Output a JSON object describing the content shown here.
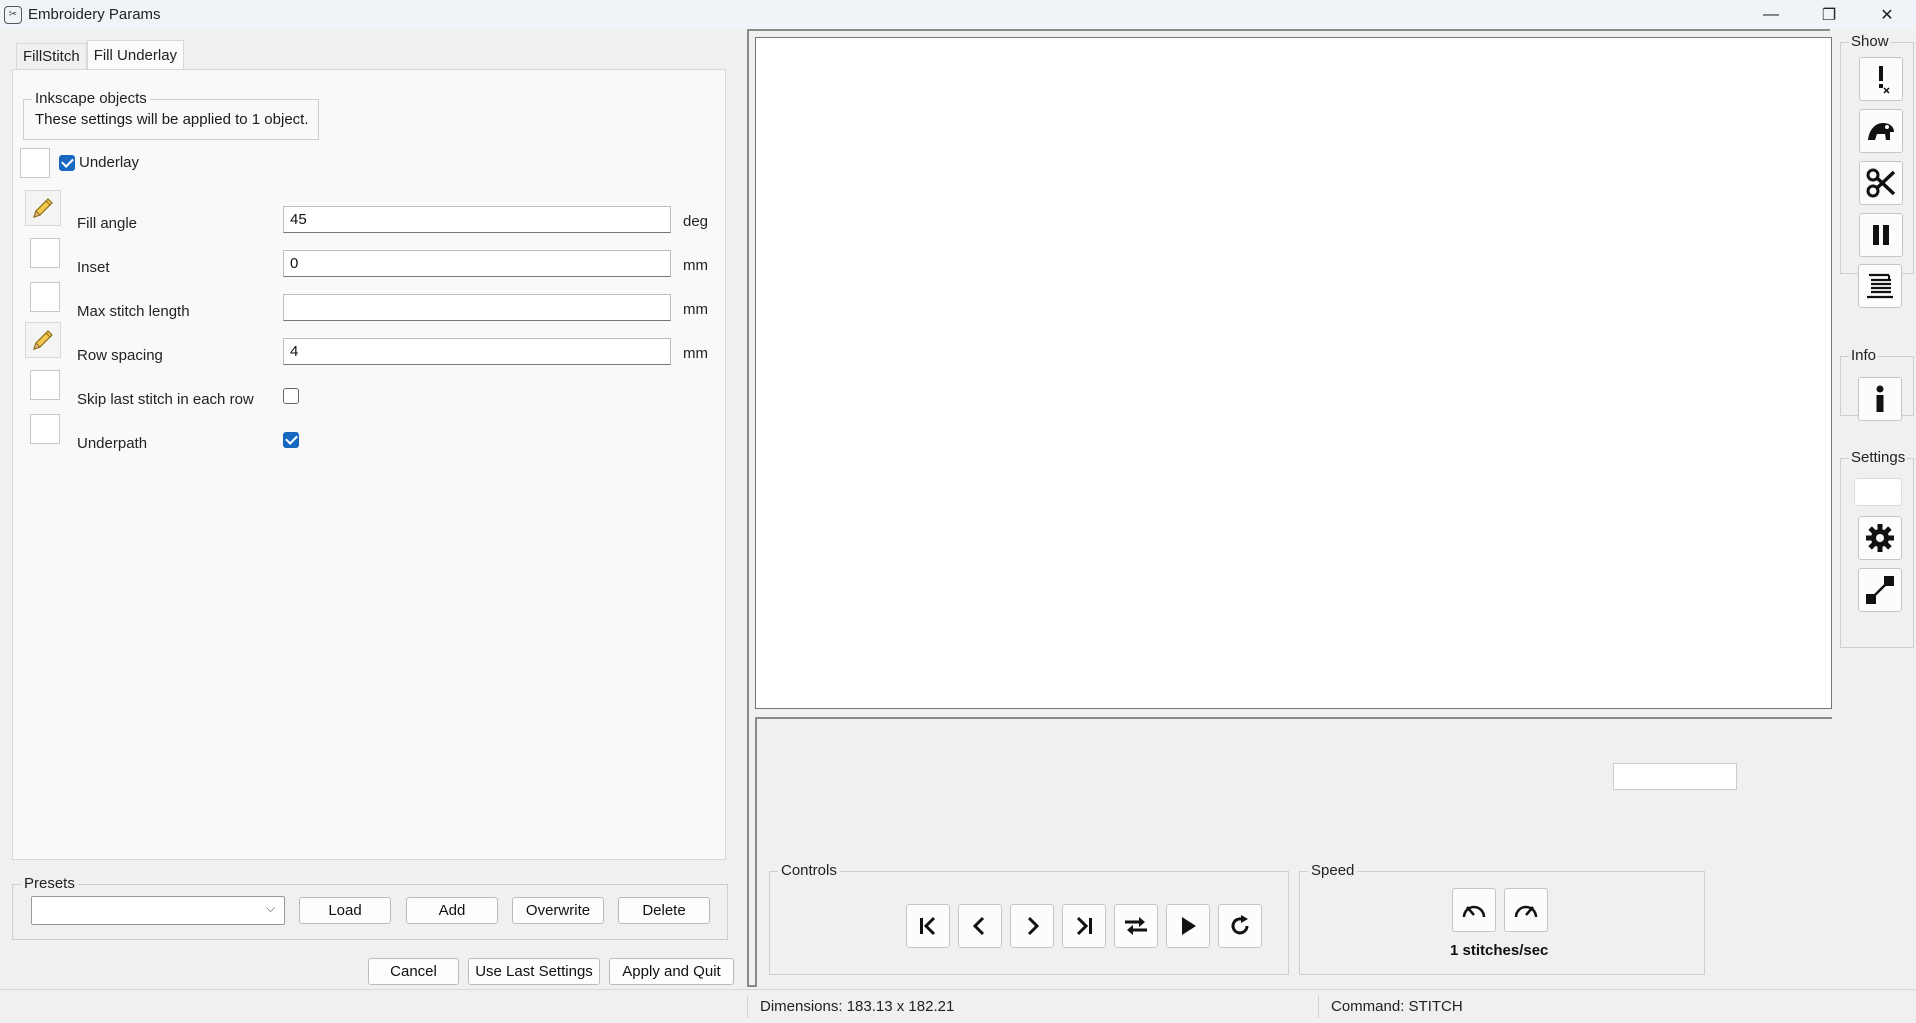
{
  "window": {
    "title": "Embroidery Params"
  },
  "tabs": [
    {
      "label": "FillStitch"
    },
    {
      "label": "Fill Underlay"
    }
  ],
  "inkscape_objects": {
    "legend": "Inkscape objects",
    "text": "These settings will be applied to 1 object."
  },
  "underlay": {
    "label": "Underlay",
    "checked": true
  },
  "params": [
    {
      "label": "Fill angle",
      "value": "45",
      "unit": "deg",
      "edited": true
    },
    {
      "label": "Inset",
      "value": "0",
      "unit": "mm",
      "edited": false
    },
    {
      "label": "Max stitch length",
      "value": "",
      "unit": "mm",
      "edited": false
    },
    {
      "label": "Row spacing",
      "value": "4",
      "unit": "mm",
      "edited": true
    },
    {
      "label": "Skip last stitch in each row",
      "checked": false
    },
    {
      "label": "Underpath",
      "checked": true
    }
  ],
  "presets": {
    "legend": "Presets",
    "selected": "",
    "load_label": "Load",
    "add_label": "Add",
    "overwrite_label": "Overwrite",
    "delete_label": "Delete"
  },
  "actions": {
    "cancel_label": "Cancel",
    "use_last_label": "Use Last Settings",
    "apply_label": "Apply and Quit"
  },
  "controls": {
    "legend": "Controls"
  },
  "speed": {
    "legend": "Speed",
    "text": "1 stitches/sec"
  },
  "side": {
    "show_legend": "Show",
    "info_legend": "Info",
    "settings_legend": "Settings"
  },
  "status": {
    "dimensions": "Dimensions: 183.13 x 182.21",
    "command": "Command: STITCH"
  },
  "colors": {
    "accent": "#1867c0"
  }
}
